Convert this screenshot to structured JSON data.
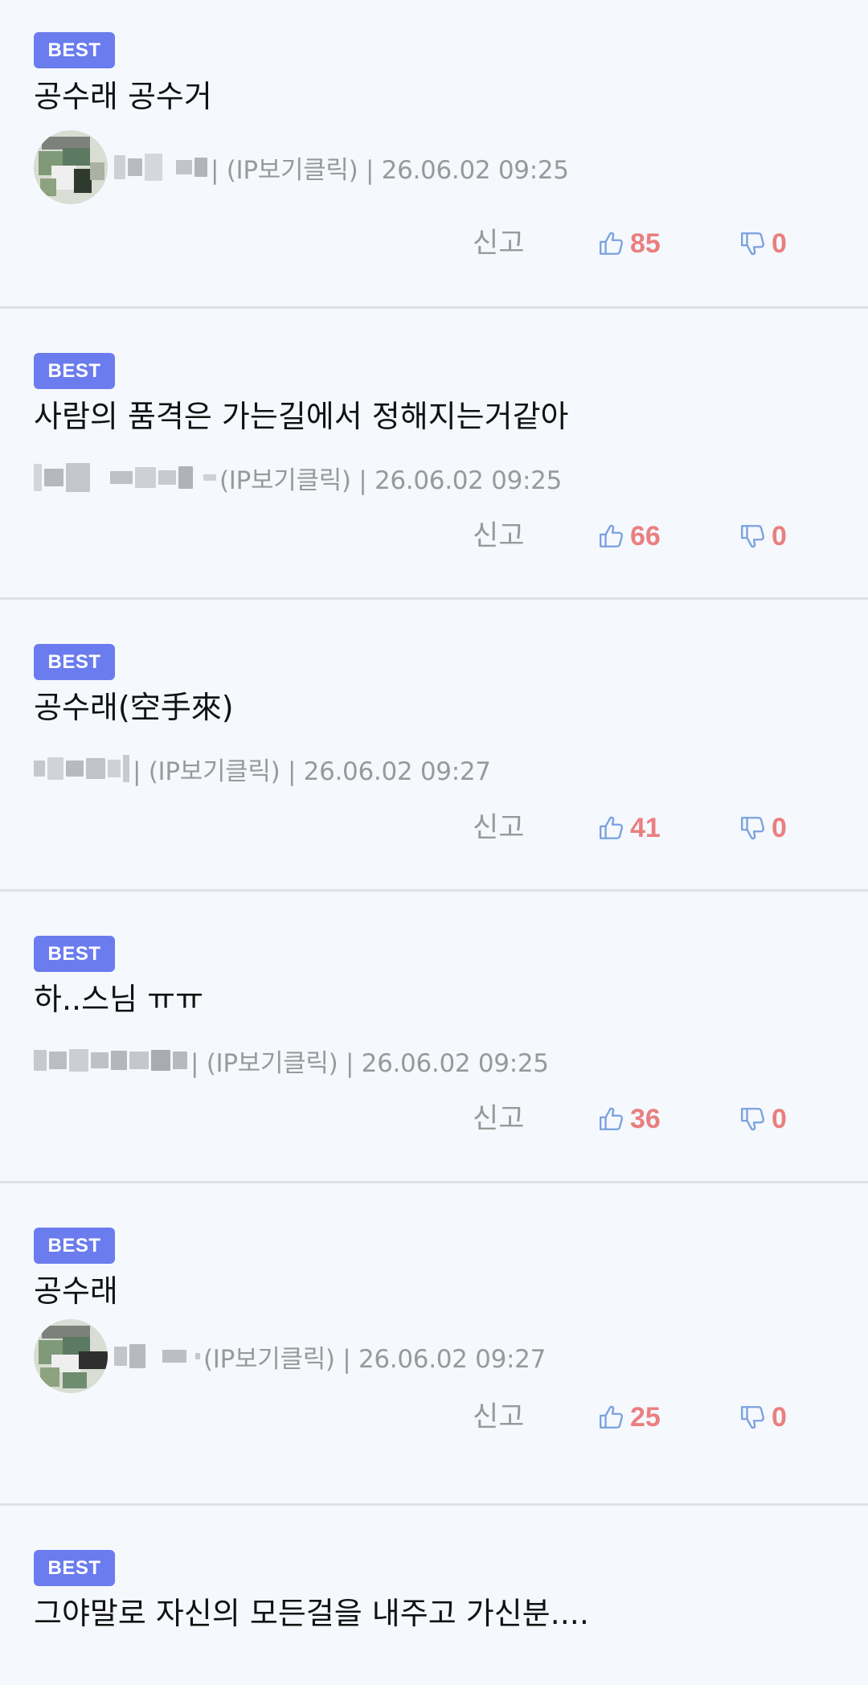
{
  "comments": [
    {
      "badge": "BEST",
      "text": "공수래 공수거",
      "meta": "| (IP보기클릭) | 26.06.02 09:25",
      "report_label": "신고",
      "likes": "85",
      "dislikes": "0"
    },
    {
      "badge": "BEST",
      "text": "사람의 품격은 가는길에서 정해지는거같아",
      "meta": "(IP보기클릭) | 26.06.02 09:25",
      "report_label": "신고",
      "likes": "66",
      "dislikes": "0"
    },
    {
      "badge": "BEST",
      "text": "공수래(空手來)",
      "meta": "| (IP보기클릭) | 26.06.02 09:27",
      "report_label": "신고",
      "likes": "41",
      "dislikes": "0"
    },
    {
      "badge": "BEST",
      "text": "하..스님 ㅠㅠ",
      "meta": "| (IP보기클릭) | 26.06.02 09:25",
      "report_label": "신고",
      "likes": "36",
      "dislikes": "0"
    },
    {
      "badge": "BEST",
      "text": "공수래",
      "meta": "(IP보기클릭) | 26.06.02 09:27",
      "report_label": "신고",
      "likes": "25",
      "dislikes": "0"
    },
    {
      "badge": "BEST",
      "text": "그야말로 자신의 모든걸을 내주고 가신분....",
      "meta": "",
      "report_label": "",
      "likes": "",
      "dislikes": ""
    }
  ],
  "icons": {
    "like": "thumbs-up-icon",
    "dislike": "thumbs-down-icon"
  },
  "colors": {
    "background": "#f5f8fd",
    "badge": "#6b7cee",
    "count": "#ea7f7f",
    "thumb_icon": "#7aa1df",
    "meta_text": "#999999",
    "divider": "#dde2ea"
  }
}
